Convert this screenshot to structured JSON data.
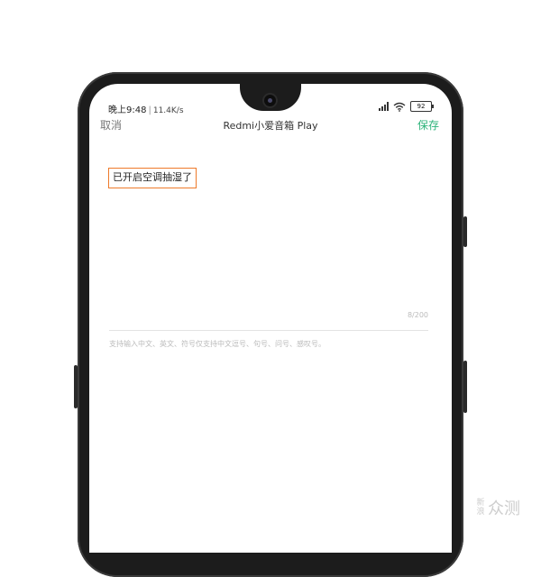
{
  "status_bar": {
    "time": "晚上9:48",
    "separator": "|",
    "net_speed": "11.4K/s",
    "battery": "92"
  },
  "navbar": {
    "cancel_label": "取消",
    "title": "Redmi小爱音箱 Play",
    "save_label": "保存",
    "save_color": "#2db37a"
  },
  "editor": {
    "text_value": "已开启空调抽湿了",
    "highlight_color": "#ee7a2a",
    "counter": "8/200",
    "hint": "支持输入中文、英文、符号仅支持中文逗号、句号、问号、感叹号。"
  },
  "watermark": {
    "small": "新浪",
    "large": "众测"
  }
}
